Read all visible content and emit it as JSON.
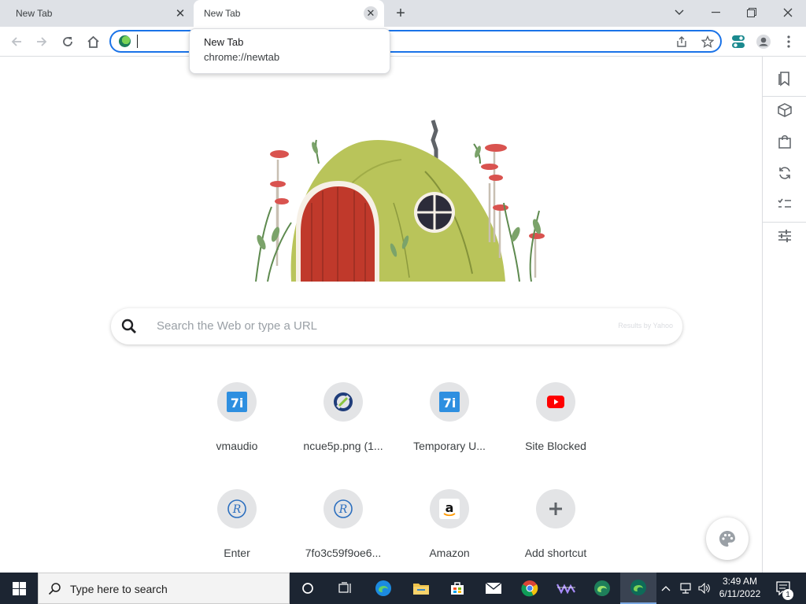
{
  "tabs": [
    {
      "title": "New Tab",
      "close": "✕"
    },
    {
      "title": "New Tab",
      "close": "✕"
    }
  ],
  "new_tab_button": "+",
  "window_controls": {
    "tab_search": "⌵",
    "minimize": "—",
    "maximize": "❐",
    "close": "✕"
  },
  "tooltip": {
    "title": "New Tab",
    "url": "chrome://newtab"
  },
  "omnibox": {
    "value": ""
  },
  "search": {
    "placeholder": "Search the Web or type a URL",
    "powered_by": "Results by Yahoo"
  },
  "shortcuts": [
    {
      "label": "vmaudio",
      "icon": "7i-icon",
      "glyph": "7i"
    },
    {
      "label": "ncue5p.png (1...",
      "icon": "link-app-icon",
      "glyph": ""
    },
    {
      "label": "Temporary U...",
      "icon": "7i-icon",
      "glyph": "7i"
    },
    {
      "label": "Site Blocked",
      "icon": "youtube-icon",
      "glyph": ""
    },
    {
      "label": "Enter",
      "icon": "r-logo-icon",
      "glyph": "R"
    },
    {
      "label": "7fo3c59f9oe6...",
      "icon": "r-logo-icon",
      "glyph": "R"
    },
    {
      "label": "Amazon",
      "icon": "amazon-icon",
      "glyph": "a"
    },
    {
      "label": "Add shortcut",
      "icon": "plus-icon",
      "glyph": "+"
    }
  ],
  "taskbar": {
    "search_text": "Type here to search",
    "time": "3:49 AM",
    "date": "6/11/2022",
    "notification_count": "1"
  },
  "colors": {
    "accent": "#1a73e8",
    "taskbar": "#1c2532",
    "tab_strip": "#dee1e6"
  }
}
